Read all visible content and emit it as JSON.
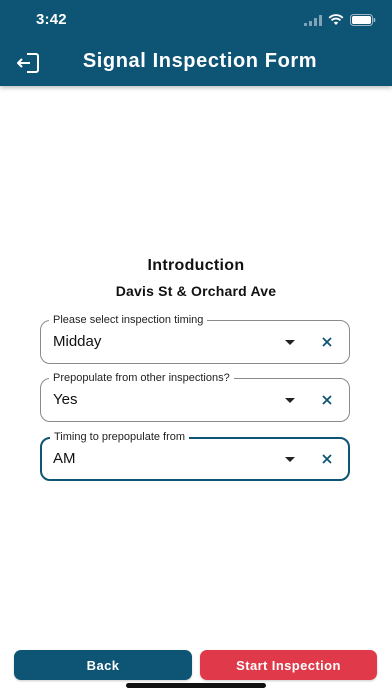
{
  "status_bar": {
    "time": "3:42"
  },
  "header": {
    "title": "Signal Inspection Form",
    "exit_icon": "exit-icon"
  },
  "intro": {
    "title": "Introduction",
    "subtitle": "Davis St & Orchard Ave"
  },
  "fields": [
    {
      "label": "Please select inspection timing",
      "value": "Midday"
    },
    {
      "label": "Prepopulate from other inspections?",
      "value": "Yes"
    },
    {
      "label": "Timing to prepopulate from",
      "value": "AM"
    }
  ],
  "buttons": {
    "back": "Back",
    "start": "Start Inspection"
  },
  "colors": {
    "primary": "#0e5475",
    "accent": "#e03a4a"
  }
}
